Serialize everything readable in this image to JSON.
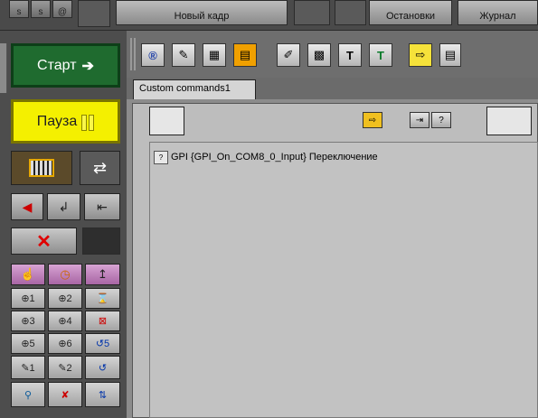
{
  "top_strip": {
    "buttons": [
      "s",
      "s",
      "@"
    ],
    "new_frame": "Новый кадр",
    "stop": "Остановки",
    "log": "Журнал"
  },
  "left_panel": {
    "start_label": "Старт",
    "start_arrow": "➔",
    "pause_label": "Пауза",
    "colors": {
      "start": "#1f6b2f",
      "pause": "#f4f000"
    }
  },
  "toolbar": {
    "icons": [
      "registered-icon",
      "edit-icon",
      "film-icon",
      "slide-icon",
      "brush-icon",
      "media-icon",
      "title-icon",
      "text-icon",
      "import-icon",
      "page-icon"
    ]
  },
  "tabs": [
    {
      "label": "Custom commands1"
    }
  ],
  "commands": [
    {
      "icon": "gpi-icon",
      "icon_text": "?",
      "text": "GPI {GPI_On_COM8_0_Input} Переключение"
    }
  ]
}
